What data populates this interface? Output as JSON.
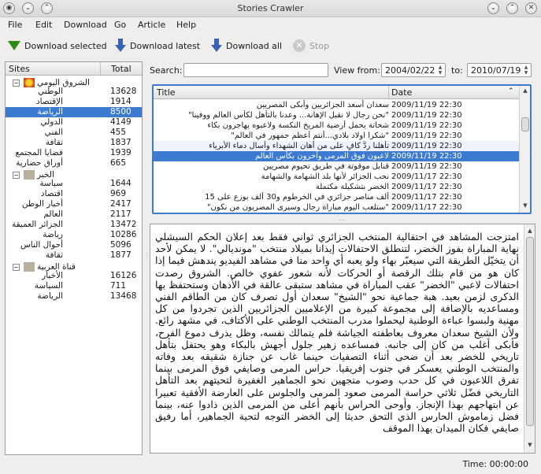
{
  "window": {
    "title": "Stories Crawler"
  },
  "menu": [
    "File",
    "Edit",
    "Download",
    "Go",
    "Article",
    "Help"
  ],
  "toolbar": {
    "download_selected": "Download selected",
    "download_latest": "Download latest",
    "download_all": "Download all",
    "stop": "Stop"
  },
  "sites_panel": {
    "col_sites": "Sites",
    "col_total": "Total",
    "tree": [
      {
        "type": "cat",
        "label": "الشروق اليومي"
      },
      {
        "type": "item",
        "label": "الوطني",
        "count": "13628"
      },
      {
        "type": "item",
        "label": "الإقتصاد",
        "count": "1914"
      },
      {
        "type": "item",
        "label": "الرياضة",
        "count": "8500",
        "selected": true
      },
      {
        "type": "item",
        "label": "الدولي",
        "count": "4149"
      },
      {
        "type": "item",
        "label": "الفني",
        "count": "455"
      },
      {
        "type": "item",
        "label": "ثقافة",
        "count": "1837"
      },
      {
        "type": "item",
        "label": "قضايا المجتمع",
        "count": "1939"
      },
      {
        "type": "item",
        "label": "أوراق حضارية",
        "count": "665"
      },
      {
        "type": "cat",
        "label": "الخبر"
      },
      {
        "type": "item",
        "label": "سياسة",
        "count": "1644"
      },
      {
        "type": "item",
        "label": "اقتصاد",
        "count": "969"
      },
      {
        "type": "item",
        "label": "أخبار الوطن",
        "count": "2417"
      },
      {
        "type": "item",
        "label": "العالم",
        "count": "2117"
      },
      {
        "type": "item",
        "label": "الجزائر العميقة",
        "count": "13472"
      },
      {
        "type": "item",
        "label": "رياضة",
        "count": "10286"
      },
      {
        "type": "item",
        "label": "أحوال الناس",
        "count": "5096"
      },
      {
        "type": "item",
        "label": "ثقافة",
        "count": "1877"
      },
      {
        "type": "cat",
        "label": "قناة العربية"
      },
      {
        "type": "item",
        "label": "الأخبار",
        "count": "16126"
      },
      {
        "type": "item",
        "label": "السياسة",
        "count": "711"
      },
      {
        "type": "item",
        "label": "الرياضة",
        "count": "13468"
      }
    ]
  },
  "search": {
    "label": "Search:",
    "value": "",
    "from_label": "View from:",
    "from_value": "2004/02/22",
    "to_label": "to:",
    "to_value": "2010/07/19"
  },
  "articles_table": {
    "col_title": "Title",
    "col_date": "Date",
    "rows": [
      {
        "title": "سعدان أسعد الجزائريين وأبكى المصريين",
        "date": "2009/11/19 22:30"
      },
      {
        "title": "\"نحن رجال لا نقبل الإهانة... وعدنا بالتأهل لكأس العالم ووفينا\"",
        "date": "2009/11/19 22:30"
      },
      {
        "title": "شحاتة يحمل أرضية المريخ النكسة ولاعبوه يهاجرون بكاء",
        "date": "2009/11/19 22:30"
      },
      {
        "title": "\"شكرا اولاد بلادي...أنتم أعظم جمهور في العالم\"",
        "date": "2009/11/19 22:30"
      },
      {
        "title": "تأهلنا ردٌّ كافٍ على من أهان الشهداء وأسال دماء الأبرياء",
        "date": "2009/11/19 22:30"
      },
      {
        "title": "لاعبون فوق المرمى وآخرون بكأس العالم",
        "date": "2009/11/19 22:30",
        "selected": true
      },
      {
        "title": "قنابل موقوتة في طريق تحيوم مصريين",
        "date": "2009/11/19 22:30"
      },
      {
        "title": "نحب الجزائر لأنها بلد الشهامة والشهامة",
        "date": "2009/11/17 22:30"
      },
      {
        "title": "الخضر بتشكيلة مكتملة",
        "date": "2009/11/17 22:30"
      },
      {
        "title": "ألف مناصر جزائري في الخرطوم و30 ألف بوزع على 15",
        "date": "2009/11/17 22:30"
      },
      {
        "title": "\"ستلعب اليوم مباراة رجال وسيرى المصريون من نكون\"",
        "date": "2009/11/17 22:30"
      }
    ]
  },
  "article_text": "امتزجت المشاهد في احتفالية المنتخب الجزائري ثواني فقط بعد إعلان الحكم السيشلي نهاية المباراة بفوز الخضر، لتنطلق الاحتفالات إيذانا بميلاد منتخب \"مونديالي\". لا يمكن لأحد أن يتخيّل الطريقة التي سيعبّر بهاء ولو يعبه أي واحد منا في مشاهد الفيديو يندهش فيما إذا كان هو من قام بتلك الرقصة أو الحركات لأنه شعور عفوي خالص. الشروق رصدت احتفالات لاعبي \"الخضر\" عقب المباراة في مشاهد ستبقى عالقة في الأذهان وستحتفظ بها الذكرى لزمن بعيد. هبة جماعية نحو \"الشيخ\" سعدان أول تصرف كان من الطاقم الفني ومساعديه بالإضافة إلى مجموعة كبيرة من الإعلاميين الجزائريين الذين تجردوا من كل مهنية ولبسوا عباءة الوطنية ليحملوا مدرب المنتخب الوطني على الأكتاف، في مشهد رائع. ولأن الشيخ سعدان معروف بعاطفته الجياشة فلم يتمالك نفسه، وظل يذرف دموع الفرح، فأبكى أغلب من كان إلى جانبه. فمساعده زهير جلول أجهش بالبكاء وهو يحتفل بتأهل تاريخي للخضر بعد أن ضحى أثناء التصفيات حينما غاب عن جنازة شقيقه بعد وفاته والمنتخب الوطني يعسكر في جنوب إفريقيا. حراس المرمى وصايفي فوق المرمى بينما تفرق اللاعبون في كل حدب وصوب متجهين نحو الجماهير الغفيرة لتحيتهم بعد التأهل التاريخي فضّل ثلاثي حراسة المرمى صعود المرمى والجلوس على العارضة الأفقية تعبيرا عن ابتهاجهم بهذا الإنجاز. وأوحى الحراس بأنهم أعلى من المرمى الذين ذادوا عنه، بينما فضل زماموش الحارس الذي التحق حديثا إلى الخضر التوجه لتحية الجماهير، أما رفيق صايفي فكان الميدان بهذا الموقف",
  "status": {
    "time": "Time: 00:00:00"
  }
}
